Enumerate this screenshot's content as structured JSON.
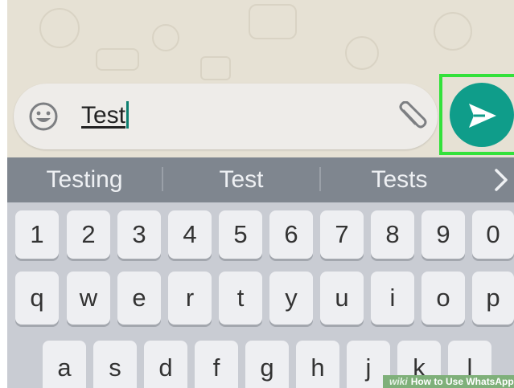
{
  "composer": {
    "message_value": "Test"
  },
  "suggestions": [
    "Testing",
    "Test",
    "Tests"
  ],
  "keyboard": {
    "row_numbers": [
      "1",
      "2",
      "3",
      "4",
      "5",
      "6",
      "7",
      "8",
      "9",
      "0"
    ],
    "row_top": [
      "q",
      "w",
      "e",
      "r",
      "t",
      "y",
      "u",
      "i",
      "o",
      "p"
    ],
    "row_home": [
      "a",
      "s",
      "d",
      "f",
      "g",
      "h",
      "j",
      "k",
      "l"
    ]
  },
  "watermark": {
    "site": "wiki",
    "title": "How to Use WhatsApp"
  },
  "icons": {
    "emoji": "smiley-face-icon",
    "attach": "paperclip-icon",
    "send": "paper-plane-send-icon",
    "more_suggestions": "chevron-right-icon"
  },
  "colors": {
    "send_button": "#0f9d8a",
    "highlight_box": "#33e13a",
    "caret": "#0d7f6f",
    "chat_background": "#e6e1d4",
    "suggestion_bar": "#7f868f"
  }
}
